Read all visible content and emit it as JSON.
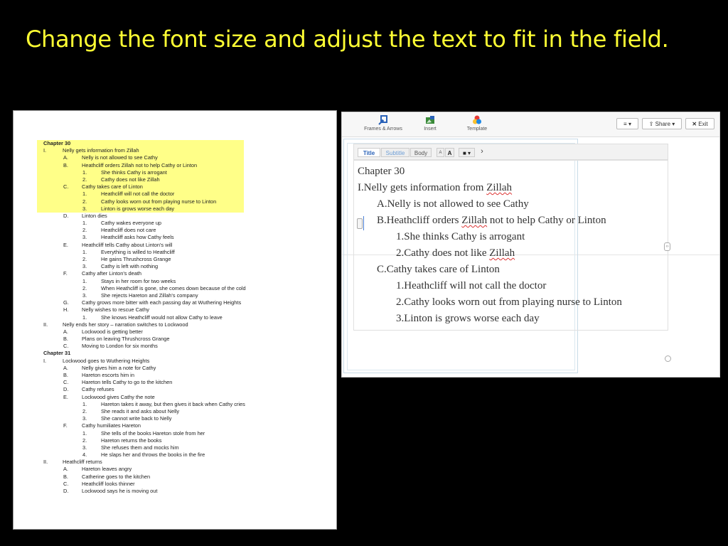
{
  "slide": {
    "title": "Change the font size and adjust the text to fit in the field."
  },
  "colors": {
    "background": "#000000",
    "title": "#ffff33",
    "highlight": "#ffff88",
    "title_tab": "#2a62b8"
  },
  "document": {
    "lines": [
      {
        "m": "",
        "t": "Chapter 30",
        "lvl": 0,
        "bold": true
      },
      {
        "m": "I.",
        "t": "Nelly gets information  from  Zillah",
        "lvl": 1
      },
      {
        "m": "A.",
        "t": "Nelly is not  allowed  to see Cathy",
        "lvl": 2
      },
      {
        "m": "B.",
        "t": "Heathcliff orders  Zillah not  to help  Cathy  or Linton",
        "lvl": 2
      },
      {
        "m": "1.",
        "t": "She thinks  Cathy  is arrogant",
        "lvl": 3
      },
      {
        "m": "2.",
        "t": "Cathy  does  not like Zillah",
        "lvl": 3
      },
      {
        "m": "C.",
        "t": "Cathy  takes  care of Linton",
        "lvl": 2
      },
      {
        "m": "1.",
        "t": "Heathcliff will not call the doctor",
        "lvl": 3
      },
      {
        "m": "2.",
        "t": "Cathy looks  worn out  from playing  nurse to Linton",
        "lvl": 3
      },
      {
        "m": "3.",
        "t": "Linton is grows worse  each  day",
        "lvl": 3
      },
      {
        "m": "D.",
        "t": "Linton  dies",
        "lvl": 2
      },
      {
        "m": "1.",
        "t": "Cathy wakes  everyone  up",
        "lvl": 3
      },
      {
        "m": "2.",
        "t": "Heathcliff  does  not care",
        "lvl": 3
      },
      {
        "m": "3.",
        "t": "Heathcliff  asks  how Cathy  feels",
        "lvl": 3
      },
      {
        "m": "E.",
        "t": "Heathcliff tells Cathy  about   Linton's  will",
        "lvl": 2
      },
      {
        "m": "1.",
        "t": "Everything  is willed to Heathcliff",
        "lvl": 3
      },
      {
        "m": "2.",
        "t": "He gains Thrushcross  Grange",
        "lvl": 3
      },
      {
        "m": "3.",
        "t": "Cathy  is left  with nothing",
        "lvl": 3
      },
      {
        "m": "F.",
        "t": "Cathy after  Linton's  death",
        "lvl": 2
      },
      {
        "m": "1.",
        "t": "Stays  in her room  for two weeks",
        "lvl": 3
      },
      {
        "m": "2.",
        "t": "When Heathcliff  is gone,  she comes down  because  of the cold",
        "lvl": 3
      },
      {
        "m": "3.",
        "t": "She rejects  Hareton  and  Zillah's company",
        "lvl": 3
      },
      {
        "m": "G.",
        "t": "Cathy grows more bitter  with each  passing  day at Wuthering  Heights",
        "lvl": 2
      },
      {
        "m": "H.",
        "t": "Nelly wishes  to rescue Cathy",
        "lvl": 2
      },
      {
        "m": "1.",
        "t": "She knows  Heathcliff  would  not allow  Cathy  to leave",
        "lvl": 3
      },
      {
        "m": "II.",
        "t": "Nelly ends  her  story – narration  switches  to Lockwood",
        "lvl": 1
      },
      {
        "m": "A.",
        "t": "Lockwood  is getting  better",
        "lvl": 2
      },
      {
        "m": "B.",
        "t": "Plans on leaving  Thrushcross  Grange",
        "lvl": 2
      },
      {
        "m": "C.",
        "t": "Moving to London   for  six months",
        "lvl": 2
      },
      {
        "m": "",
        "t": "Chapter 31",
        "lvl": 0,
        "bold": true
      },
      {
        "m": "I.",
        "t": "Lockwood  goes  to Wuthering  Heights",
        "lvl": 1
      },
      {
        "m": "A.",
        "t": "Nelly gives him a note  for Cathy",
        "lvl": 2
      },
      {
        "m": "B.",
        "t": "Hareton  escorts  him in",
        "lvl": 2
      },
      {
        "m": "C.",
        "t": "Hareton  tells Cathy  to go to the  kitchen",
        "lvl": 2
      },
      {
        "m": "D.",
        "t": "Cathy refuses",
        "lvl": 2
      },
      {
        "m": "E.",
        "t": "Lockwood  gives Cathy  the note",
        "lvl": 2
      },
      {
        "m": "1.",
        "t": "Hareton  takes  it away,  but then  gives it back  when  Cathy  cries",
        "lvl": 3
      },
      {
        "m": "2.",
        "t": "She reads  it and asks  about  Nelly",
        "lvl": 3
      },
      {
        "m": "3.",
        "t": "She cannot   write back  to Nelly",
        "lvl": 3
      },
      {
        "m": "F.",
        "t": "Cathy humiliates  Hareton",
        "lvl": 2
      },
      {
        "m": "1.",
        "t": "She tells of the books  Hareton  stole  from her",
        "lvl": 3
      },
      {
        "m": "2.",
        "t": "Hareton  returns  the books",
        "lvl": 3
      },
      {
        "m": "3.",
        "t": "She refuses  them  and mocks  him",
        "lvl": 3
      },
      {
        "m": "4.",
        "t": "He slaps  her and throws  the books  in the fire",
        "lvl": 3
      },
      {
        "m": "II.",
        "t": "Heathcliff  returns",
        "lvl": 1
      },
      {
        "m": "A.",
        "t": "Hareton  leaves  angry",
        "lvl": 2
      },
      {
        "m": "B.",
        "t": "Catherine  goes  to the kitchen",
        "lvl": 2
      },
      {
        "m": "C.",
        "t": "Heathcliff  looks  thinner",
        "lvl": 2
      },
      {
        "m": "D.",
        "t": "Lockwood  says  he is moving  out",
        "lvl": 2
      }
    ]
  },
  "editor": {
    "toolbar": {
      "frames_arrows": "Frames & Arrows",
      "insert": "Insert",
      "template": "Template",
      "menu_icon_label": "≡ ▾",
      "share": "Share ▾",
      "exit": "Exit"
    },
    "format_bar": {
      "title": "Title",
      "subtitle": "Subtitle",
      "body": "Body",
      "font_smaller": "A",
      "font_larger": "A",
      "color": "■ ▾",
      "more": "›"
    },
    "text_lines": [
      {
        "segments": [
          {
            "text": "Chapter 30"
          }
        ],
        "indent": 0
      },
      {
        "segments": [
          {
            "text": "I.Nelly gets information from "
          },
          {
            "text": "Zillah",
            "spell": true
          }
        ],
        "indent": 0
      },
      {
        "segments": [
          {
            "text": "A.Nelly is not allowed to see Cathy"
          }
        ],
        "indent": 1
      },
      {
        "segments": [
          {
            "text": "B.Heathcliff orders "
          },
          {
            "text": "Zillah",
            "spell": true
          },
          {
            "text": " not to help Cathy or Linton"
          }
        ],
        "indent": 1
      },
      {
        "segments": [
          {
            "text": "1.She thinks Cathy is arrogant"
          }
        ],
        "indent": 2
      },
      {
        "segments": [
          {
            "text": "2.Cathy does not like "
          },
          {
            "text": "Zillah",
            "spell": true
          }
        ],
        "indent": 2
      },
      {
        "segments": [
          {
            "text": "C.Cathy takes care of Linton"
          }
        ],
        "indent": 1
      },
      {
        "segments": [
          {
            "text": "1.Heathcliff will not call the doctor"
          }
        ],
        "indent": 2
      },
      {
        "segments": [
          {
            "text": "2.Cathy looks worn out from playing nurse to Linton"
          }
        ],
        "indent": 2
      },
      {
        "segments": [
          {
            "text": "3.Linton is grows worse each day"
          }
        ],
        "indent": 2
      }
    ]
  }
}
